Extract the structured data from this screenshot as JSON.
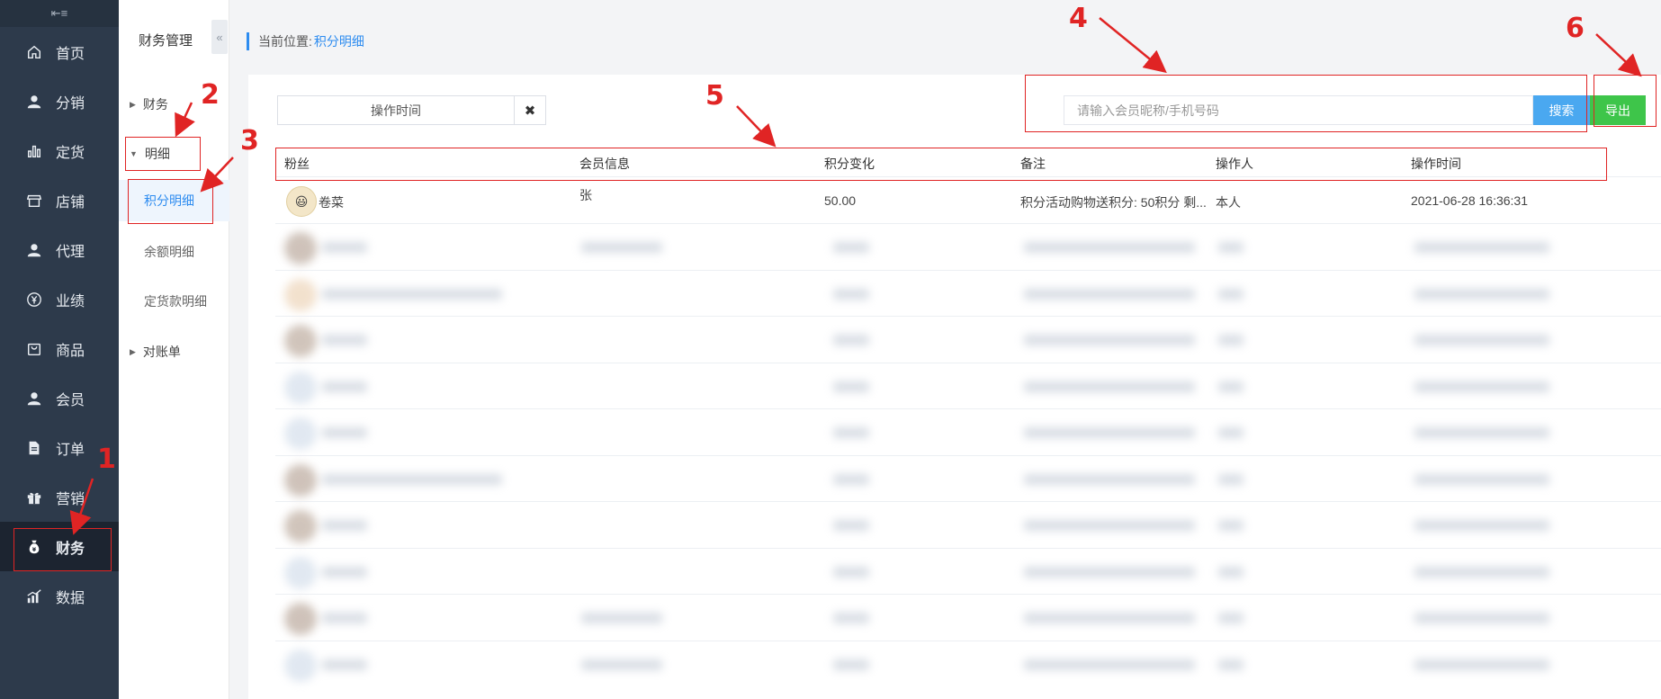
{
  "nav": {
    "collapse_glyph": "⇤≡",
    "items": [
      {
        "label": "首页",
        "icon": "home-icon"
      },
      {
        "label": "分销",
        "icon": "user-icon"
      },
      {
        "label": "定货",
        "icon": "bar-chart-icon"
      },
      {
        "label": "店铺",
        "icon": "store-icon"
      },
      {
        "label": "代理",
        "icon": "user-icon"
      },
      {
        "label": "业绩",
        "icon": "yen-circle-icon"
      },
      {
        "label": "商品",
        "icon": "bag-icon"
      },
      {
        "label": "会员",
        "icon": "user-icon"
      },
      {
        "label": "订单",
        "icon": "document-icon"
      },
      {
        "label": "营销",
        "icon": "gift-icon"
      },
      {
        "label": "财务",
        "icon": "money-bag-icon",
        "active": true
      },
      {
        "label": "数据",
        "icon": "stats-icon"
      }
    ]
  },
  "subnav": {
    "title": "财务管理",
    "collapse_glyph": "«",
    "groups": {
      "finance": "财务",
      "detail": "明细",
      "statement": "对账单"
    },
    "items": {
      "points_detail": "积分明细",
      "balance_detail": "余额明细",
      "order_payment_detail": "定货款明细"
    }
  },
  "breadcrumb": {
    "prefix": "当前位置:",
    "current": "积分明细"
  },
  "filters": {
    "date_label": "操作时间",
    "clear_glyph": "✖",
    "search_placeholder": "请输入会员昵称/手机号码",
    "search_button": "搜索",
    "export_button": "导出"
  },
  "table": {
    "columns": [
      "粉丝",
      "会员信息",
      "积分变化",
      "备注",
      "操作人",
      "操作时间"
    ],
    "first_row": {
      "fan": "卷菜",
      "member_info": "张",
      "points": "50.00",
      "remark": "积分活动购物送积分: 50积分 剩...",
      "operator": "本人",
      "time": "2021-06-28 16:36:31"
    }
  },
  "annotations": [
    "1",
    "2",
    "3",
    "4",
    "5",
    "6"
  ],
  "colors": {
    "nav_bg": "#2d3a4b",
    "accent": "#2d8cf0",
    "search_btn": "#4aa8f0",
    "export_btn": "#3ec54a",
    "annotation": "#e02424"
  }
}
